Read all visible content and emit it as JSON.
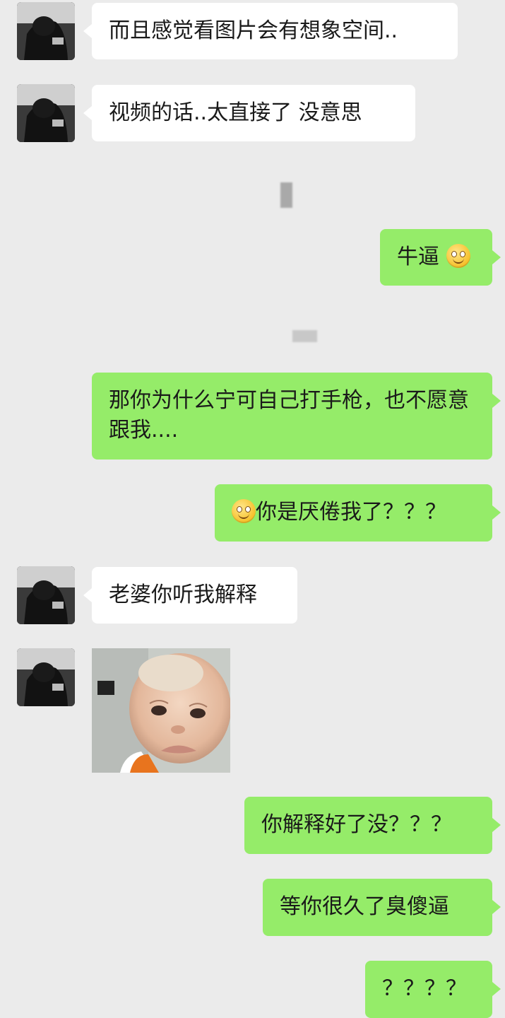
{
  "messages": [
    {
      "side": "left",
      "text": "而且感觉看图片会有想象空间.."
    },
    {
      "side": "left",
      "text": "视频的话..太直接了 没意思"
    },
    {
      "side": "right",
      "text": "牛逼",
      "emoji_after": "smile-emoji"
    },
    {
      "side": "right",
      "text": "那你为什么宁可自己打手枪，也不愿意跟我...."
    },
    {
      "side": "right",
      "text": "你是厌倦我了？？？",
      "emoji_before": "smile-emoji"
    },
    {
      "side": "left",
      "text": "老婆你听我解释"
    },
    {
      "side": "left",
      "image": "crying-baby-sticker"
    },
    {
      "side": "right",
      "text": "你解释好了没？？？"
    },
    {
      "side": "right",
      "text": "等你很久了臭傻逼"
    },
    {
      "side": "right",
      "text": "？？？？"
    }
  ],
  "colors": {
    "background": "#ebebeb",
    "incoming_bubble": "#ffffff",
    "outgoing_bubble": "#95ec69",
    "text": "#1a1a1a"
  }
}
